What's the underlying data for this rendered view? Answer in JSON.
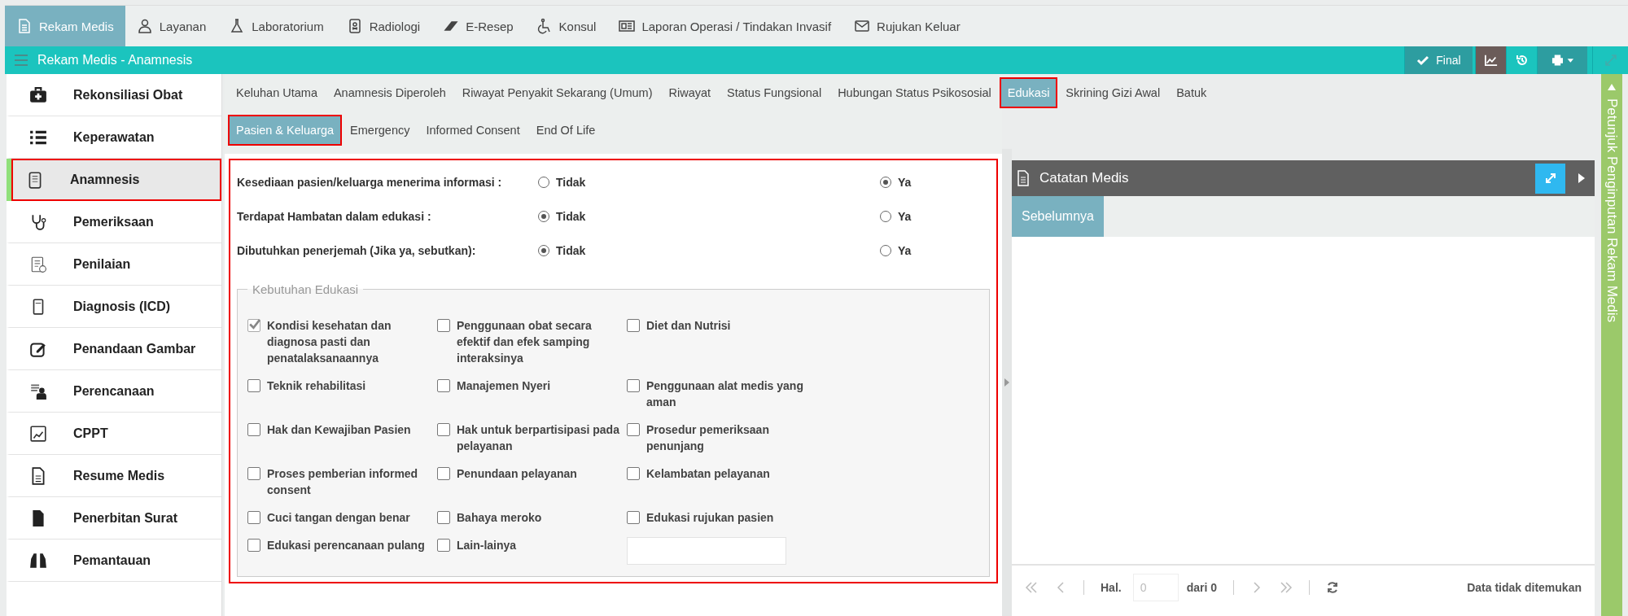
{
  "top_nav": [
    {
      "label": "Rekam Medis",
      "selected": true
    },
    {
      "label": "Layanan",
      "selected": false
    },
    {
      "label": "Laboratorium",
      "selected": false
    },
    {
      "label": "Radiologi",
      "selected": false
    },
    {
      "label": "E-Resep",
      "selected": false
    },
    {
      "label": "Konsul",
      "selected": false
    },
    {
      "label": "Laporan Operasi / Tindakan Invasif",
      "selected": false
    },
    {
      "label": "Rujukan Keluar",
      "selected": false
    }
  ],
  "title_bar": {
    "title": "Rekam Medis - Anamnesis",
    "final_button": "Final"
  },
  "sidebar": {
    "items": [
      {
        "label": "Rekonsiliasi Obat",
        "selected": false
      },
      {
        "label": "Keperawatan",
        "selected": false
      },
      {
        "label": "Anamnesis",
        "selected": true
      },
      {
        "label": "Pemeriksaan",
        "selected": false
      },
      {
        "label": "Penilaian",
        "selected": false
      },
      {
        "label": "Diagnosis (ICD)",
        "selected": false
      },
      {
        "label": "Penandaan Gambar",
        "selected": false
      },
      {
        "label": "Perencanaan",
        "selected": false
      },
      {
        "label": "CPPT",
        "selected": false
      },
      {
        "label": "Resume Medis",
        "selected": false
      },
      {
        "label": "Penerbitan Surat",
        "selected": false
      },
      {
        "label": "Pemantauan",
        "selected": false
      }
    ]
  },
  "tabs": [
    {
      "label": "Keluhan Utama",
      "selected": false
    },
    {
      "label": "Anamnesis Diperoleh",
      "selected": false
    },
    {
      "label": "Riwayat Penyakit Sekarang (Umum)",
      "selected": false
    },
    {
      "label": "Riwayat",
      "selected": false
    },
    {
      "label": "Status Fungsional",
      "selected": false
    },
    {
      "label": "Hubungan Status Psikososial",
      "selected": false
    },
    {
      "label": "Edukasi",
      "selected": true
    },
    {
      "label": "Skrining Gizi Awal",
      "selected": false
    },
    {
      "label": "Batuk",
      "selected": false
    }
  ],
  "sub_tabs": [
    {
      "label": "Pasien & Keluarga",
      "selected": true
    },
    {
      "label": "Emergency",
      "selected": false
    },
    {
      "label": "Informed Consent",
      "selected": false
    },
    {
      "label": "End Of Life",
      "selected": false
    }
  ],
  "questions": [
    {
      "label": "Kesediaan pasien/keluarga menerima informasi :",
      "options": [
        {
          "label": "Tidak",
          "selected": false
        },
        {
          "label": "Ya",
          "selected": true
        }
      ]
    },
    {
      "label": "Terdapat Hambatan dalam edukasi :",
      "options": [
        {
          "label": "Tidak",
          "selected": true
        },
        {
          "label": "Ya",
          "selected": false
        }
      ]
    },
    {
      "label": "Dibutuhkan penerjemah (Jika ya, sebutkan):",
      "options": [
        {
          "label": "Tidak",
          "selected": true
        },
        {
          "label": "Ya",
          "selected": false
        }
      ]
    }
  ],
  "education_needs": {
    "legend": "Kebutuhan Edukasi",
    "items": [
      {
        "kind": "checkbox",
        "label": "Kondisi kesehatan dan diagnosa pasti dan penatalaksanaannya",
        "checked": true
      },
      {
        "kind": "checkbox",
        "label": "Penggunaan obat secara efektif dan efek samping interaksinya",
        "checked": false
      },
      {
        "kind": "checkbox",
        "label": "Diet dan Nutrisi",
        "checked": false
      },
      {
        "kind": "checkbox",
        "label": "Teknik rehabilitasi",
        "checked": false
      },
      {
        "kind": "checkbox",
        "label": "Manajemen Nyeri",
        "checked": false
      },
      {
        "kind": "checkbox",
        "label": "Penggunaan alat medis yang aman",
        "checked": false
      },
      {
        "kind": "checkbox",
        "label": "Hak dan Kewajiban Pasien",
        "checked": false
      },
      {
        "kind": "checkbox",
        "label": "Hak untuk berpartisipasi pada pelayanan",
        "checked": false
      },
      {
        "kind": "checkbox",
        "label": "Prosedur pemeriksaan penunjang",
        "checked": false
      },
      {
        "kind": "checkbox",
        "label": "Proses pemberian informed consent",
        "checked": false
      },
      {
        "kind": "checkbox",
        "label": "Penundaan pelayanan",
        "checked": false
      },
      {
        "kind": "checkbox",
        "label": "Kelambatan pelayanan",
        "checked": false
      },
      {
        "kind": "checkbox",
        "label": "Cuci tangan dengan benar",
        "checked": false
      },
      {
        "kind": "checkbox",
        "label": "Bahaya meroko",
        "checked": false
      },
      {
        "kind": "checkbox",
        "label": "Edukasi rujukan pasien",
        "checked": false
      },
      {
        "kind": "checkbox",
        "label": "Edukasi perencanaan pulang",
        "checked": false
      },
      {
        "kind": "checkbox",
        "label": "Lain-lainya",
        "checked": false
      },
      {
        "kind": "text_field"
      }
    ]
  },
  "medical_notes": {
    "title": "Catatan Medis",
    "tabs": [
      {
        "label": "Sebelumnya",
        "selected": true
      }
    ],
    "pager": {
      "page_label": "Hal.",
      "page_value": "0",
      "of_label": "dari 0",
      "status": "Data tidak ditemukan"
    }
  },
  "side_panel": {
    "label": "Petunjuk Penginputan Rekam Medis"
  }
}
